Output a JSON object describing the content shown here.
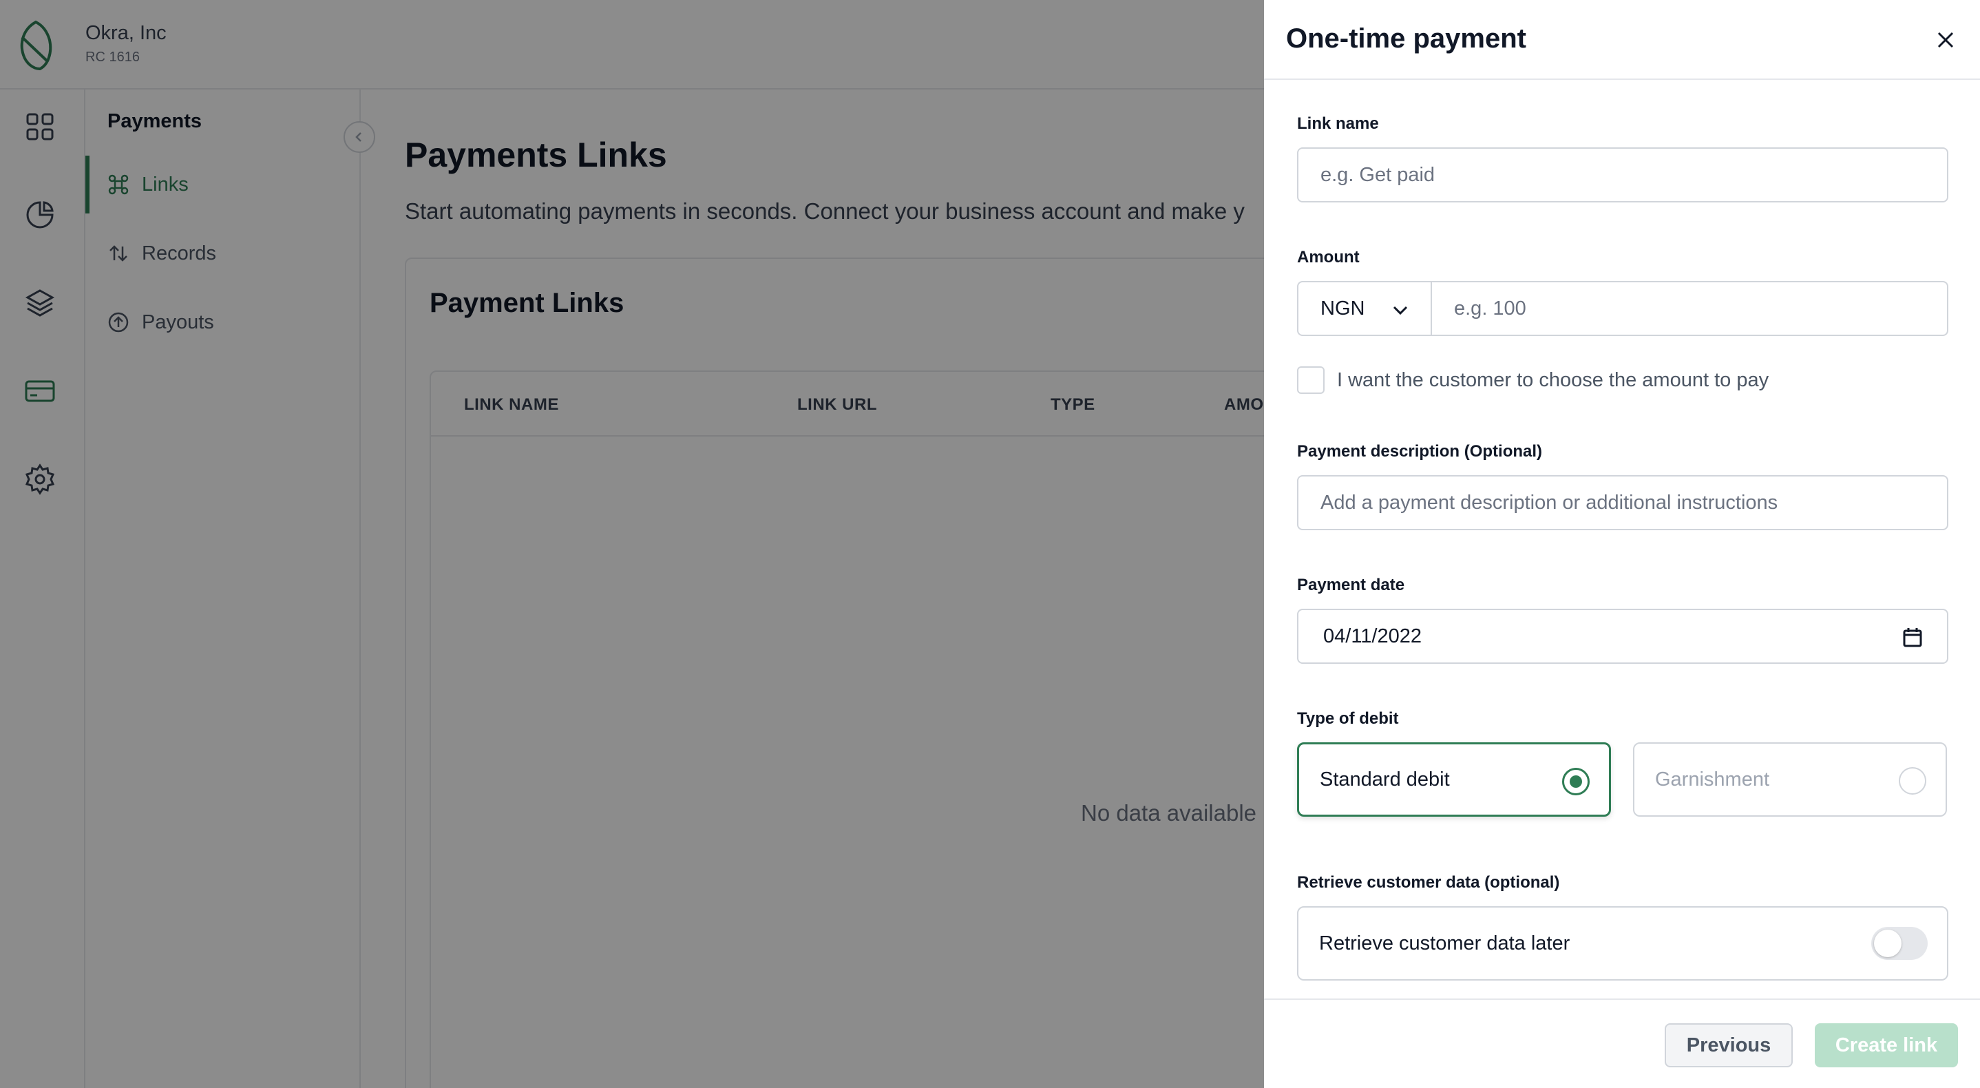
{
  "org": {
    "name": "Okra, Inc",
    "rc": "RC 1616"
  },
  "rail": {
    "icons": [
      "dashboard-icon",
      "analytics-icon",
      "layers-icon",
      "card-icon",
      "settings-icon"
    ],
    "active_icon": "card-icon"
  },
  "subnav": {
    "title": "Payments",
    "items": [
      {
        "label": "Links",
        "icon": "link-icon",
        "active": true
      },
      {
        "label": "Records",
        "icon": "arrows-icon",
        "active": false
      },
      {
        "label": "Payouts",
        "icon": "upload-icon",
        "active": false
      }
    ]
  },
  "main": {
    "title": "Payments Links",
    "subtitle": "Start automating payments in seconds. Connect your business account and make y",
    "card_title": "Payment Links",
    "columns": [
      "LINK NAME",
      "LINK URL",
      "TYPE",
      "AMOU"
    ],
    "empty_text": "No data available"
  },
  "drawer": {
    "title": "One-time payment",
    "link_name": {
      "label": "Link name",
      "placeholder": "e.g. Get paid",
      "value": ""
    },
    "amount": {
      "label": "Amount",
      "currency": "NGN",
      "placeholder": "e.g. 100",
      "value": ""
    },
    "customer_amount_checkbox": {
      "label": "I want the customer to choose the amount to pay",
      "checked": false
    },
    "description": {
      "label": "Payment description (Optional)",
      "placeholder": "Add a payment description or additional instructions",
      "value": ""
    },
    "payment_date": {
      "label": "Payment date",
      "value": "04/11/2022"
    },
    "debit_type": {
      "label": "Type of debit",
      "options": [
        {
          "label": "Standard debit",
          "selected": true
        },
        {
          "label": "Garnishment",
          "selected": false
        }
      ]
    },
    "retrieve": {
      "label": "Retrieve customer data (optional)",
      "toggle_label": "Retrieve customer data later",
      "enabled": false
    },
    "buttons": {
      "previous": "Previous",
      "create": "Create link"
    }
  },
  "colors": {
    "accent": "#2f7d55",
    "create_disabled": "#b8e0cb",
    "overlay": "rgba(0,0,0,0.45)"
  }
}
